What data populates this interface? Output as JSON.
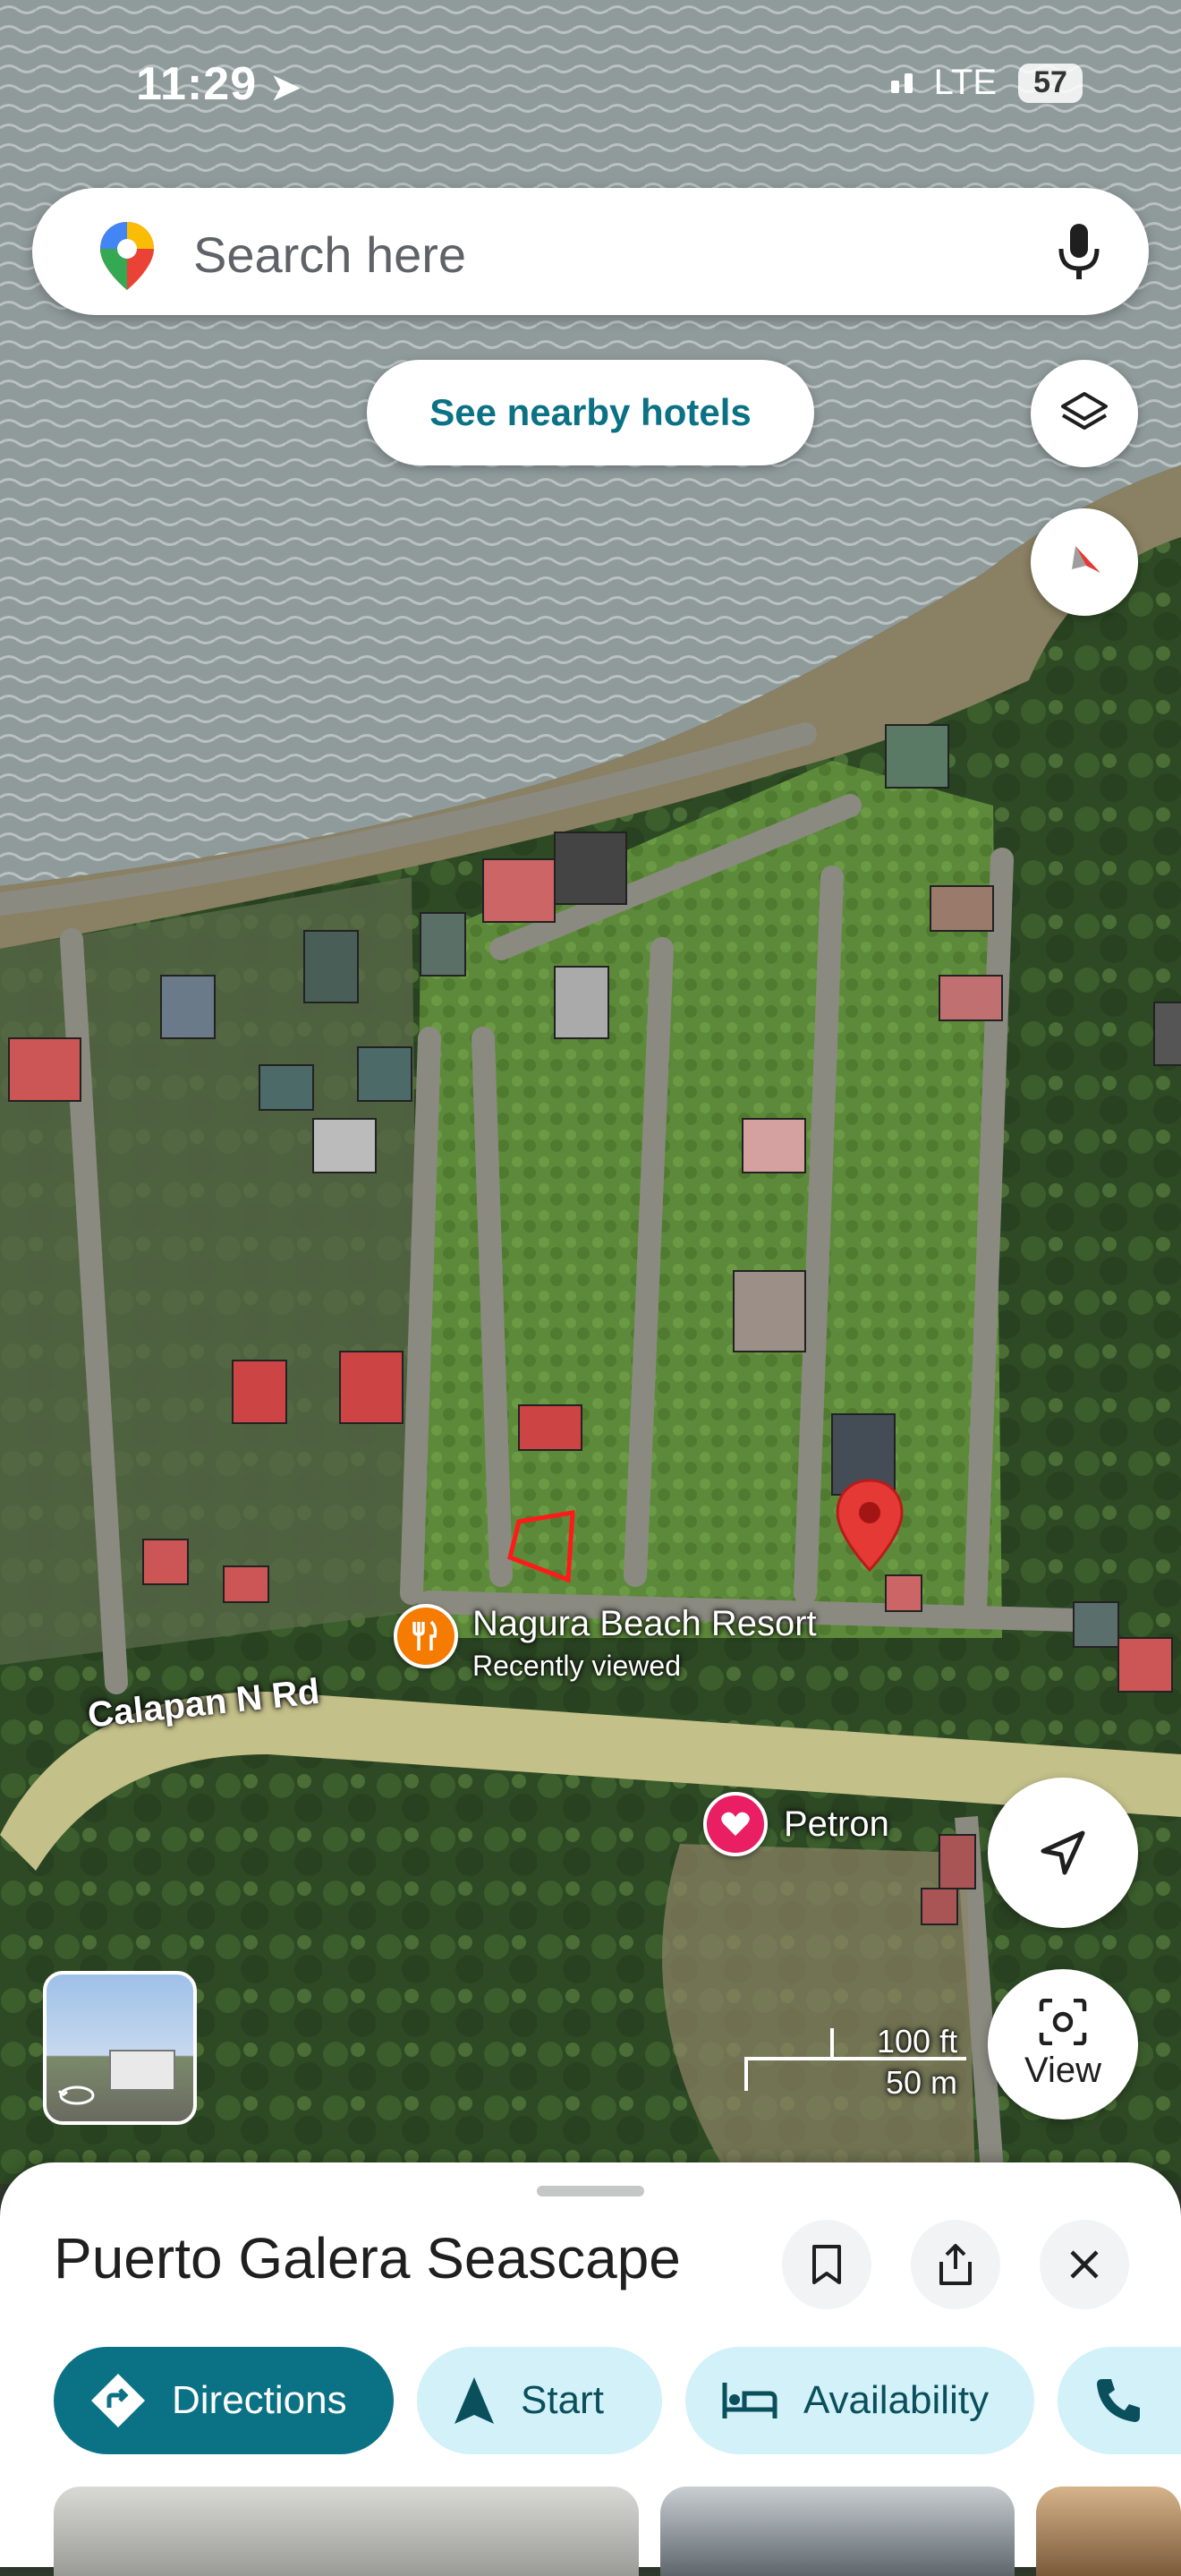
{
  "status": {
    "time": "11:29",
    "network": "LTE",
    "battery": "57"
  },
  "search": {
    "placeholder": "Search here"
  },
  "chip": {
    "hotels": "See nearby hotels"
  },
  "map": {
    "road_label": "Calapan N Rd",
    "poi_resort": {
      "name": "Nagura Beach Resort",
      "sub": "Recently viewed"
    },
    "poi_petron": {
      "name": "Petron"
    },
    "scale_ft": "100 ft",
    "scale_m": "50 m"
  },
  "controls": {
    "view_label": "View"
  },
  "sheet": {
    "title": "Puerto Galera Seascape",
    "actions": [
      {
        "label": "Directions"
      },
      {
        "label": "Start"
      },
      {
        "label": "Availability"
      }
    ]
  },
  "colors": {
    "accent": "#0b7285",
    "chip_light": "#d2f1f9",
    "pin_red": "#e53935",
    "poi_orange": "#f57c00",
    "poi_pink": "#e91e63"
  }
}
